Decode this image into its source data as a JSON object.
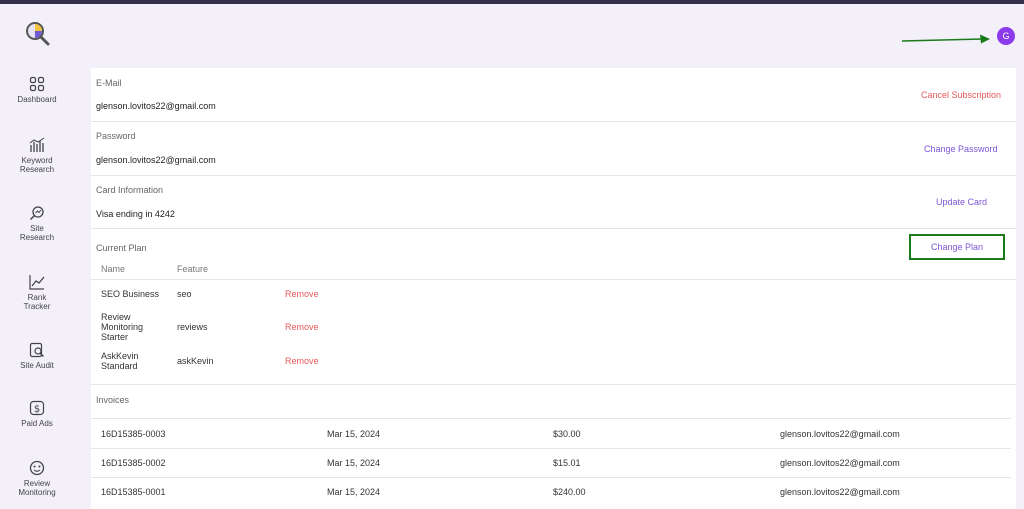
{
  "header": {
    "avatar_letter": "G"
  },
  "sidebar": {
    "items": [
      {
        "label": "Dashboard",
        "icon": "dashboard-icon"
      },
      {
        "label": "Keyword\nResearch",
        "icon": "bar-chart-icon"
      },
      {
        "label": "Site\nResearch",
        "icon": "site-research-icon"
      },
      {
        "label": "Rank\nTracker",
        "icon": "trend-icon"
      },
      {
        "label": "Site Audit",
        "icon": "audit-icon"
      },
      {
        "label": "Paid Ads",
        "icon": "dollar-icon"
      },
      {
        "label": "Review\nMonitoring",
        "icon": "smiley-icon"
      }
    ]
  },
  "account": {
    "email": {
      "label": "E-Mail",
      "value": "glenson.lovitos22@gmail.com",
      "action": "Cancel Subscription"
    },
    "password": {
      "label": "Password",
      "value": "glenson.lovitos22@gmail.com",
      "action": "Change Password"
    },
    "card": {
      "label": "Card Information",
      "value": "Visa ending in 4242",
      "action": "Update Card"
    }
  },
  "plan": {
    "label": "Current Plan",
    "action": "Change Plan",
    "columns": [
      "Name",
      "Feature"
    ],
    "rows": [
      {
        "name": "SEO Business",
        "feature": "seo",
        "action": "Remove"
      },
      {
        "name": "Review\nMonitoring\nStarter",
        "feature": "reviews",
        "action": "Remove"
      },
      {
        "name": "AskKevin\nStandard",
        "feature": "askKevin",
        "action": "Remove"
      }
    ]
  },
  "invoices": {
    "label": "Invoices",
    "rows": [
      {
        "id": "16D15385-0003",
        "date": "Mar 15, 2024",
        "amount": "$30.00",
        "email": "glenson.lovitos22@gmail.com"
      },
      {
        "id": "16D15385-0002",
        "date": "Mar 15, 2024",
        "amount": "$15.01",
        "email": "glenson.lovitos22@gmail.com"
      },
      {
        "id": "16D15385-0001",
        "date": "Mar 15, 2024",
        "amount": "$240.00",
        "email": "glenson.lovitos22@gmail.com"
      }
    ]
  },
  "colors": {
    "accent": "#8b3bea",
    "link": "#7d55d6",
    "danger": "#e65a5a",
    "highlight": "#1a7a1a"
  }
}
